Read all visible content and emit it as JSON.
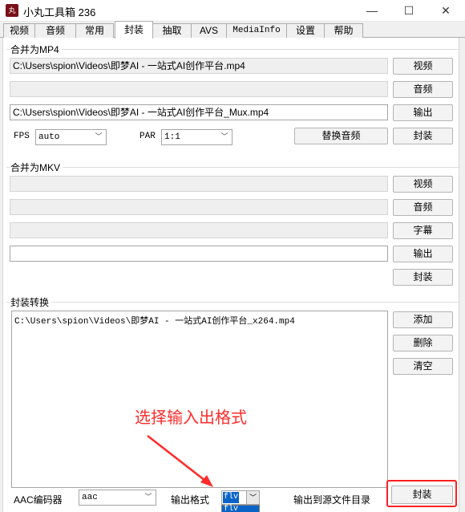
{
  "window": {
    "icon_text": "丸",
    "title": "小丸工具箱 236",
    "minimize": "—",
    "maximize": "☐",
    "close": "✕"
  },
  "tabs": [
    "视频",
    "音频",
    "常用",
    "封装",
    "抽取",
    "AVS",
    "MediaInfo",
    "设置",
    "帮助"
  ],
  "active_tab": "封装",
  "mp4_group": {
    "title": "合并为MP4",
    "video_path": "C:\\Users\\spion\\Videos\\即梦AI - 一站式AI创作平台.mp4",
    "audio_path": "",
    "output_path": "C:\\Users\\spion\\Videos\\即梦AI - 一站式AI创作平台_Mux.mp4",
    "video_button": "视频",
    "audio_button": "音频",
    "output_button": "输出",
    "mux_button": "封装",
    "fps_label": "FPS",
    "fps_value": "auto",
    "par_label": "PAR",
    "par_value": "1:1",
    "replace_audio_button": "替换音频"
  },
  "mkv_group": {
    "title": "合并为MKV",
    "video_path": "",
    "audio_path": "",
    "subtitle_path": "",
    "output_path": "",
    "video_button": "视频",
    "audio_button": "音频",
    "subtitle_button": "字幕",
    "output_button": "输出",
    "mux_button": "封装"
  },
  "convert_group": {
    "title": "封装转换",
    "files": [
      "C:\\Users\\spion\\Videos\\即梦AI - 一站式AI创作平台_x264.mp4"
    ],
    "add_button": "添加",
    "delete_button": "删除",
    "clear_button": "清空",
    "aac_encoder_label": "AAC编码器",
    "aac_encoder_value": "aac",
    "output_format_label": "输出格式",
    "output_format_value": "flv",
    "dropdown_option": "flv",
    "output_to_source_label": "输出到源文件目录",
    "mux_button": "封装"
  },
  "annotation": {
    "text": "选择输入出格式",
    "color": "#ff2b2b"
  },
  "colors": {
    "selection": "#0a64c8",
    "highlight": "#ff2020"
  }
}
